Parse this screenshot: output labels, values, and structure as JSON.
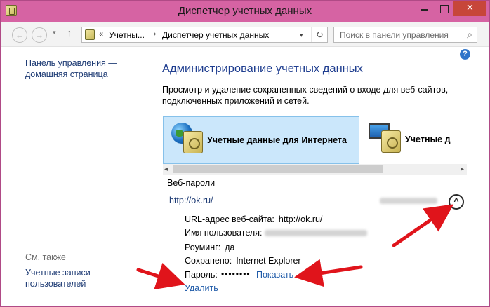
{
  "window": {
    "title": "Диспетчер учетных данных",
    "close_glyph": "✕"
  },
  "nav": {
    "back_glyph": "←",
    "forward_glyph": "→",
    "up_glyph": "↑",
    "dropdown_glyph": "▾",
    "address_chevron": "«",
    "address_segments": [
      "Учетны...",
      "Диспетчер учетных данных"
    ],
    "address_sep": "›",
    "refresh_glyph": "↻",
    "search_placeholder": "Поиск в панели управления",
    "search_glyph": "⌕"
  },
  "help_glyph": "?",
  "left_pane": {
    "home_link": "Панель управления — домашняя страница",
    "see_also": "См. также",
    "user_accounts_link": "Учетные записи пользователей"
  },
  "main": {
    "heading": "Администрирование учетных данных",
    "description": "Просмотр и удаление сохраненных сведений о входе для веб-сайтов, подключенных приложений и сетей.",
    "tiles": [
      {
        "label": "Учетные данные для Интернета",
        "icon": "globe-icon",
        "selected": true
      },
      {
        "label": "Учетные д",
        "icon": "monitor-icon",
        "selected": false
      }
    ],
    "scroll_left_glyph": "◂",
    "scroll_right_glyph": "▸",
    "section_title": "Веб-пароли",
    "entry": {
      "url": "http://ok.ru/",
      "collapse_glyph": "^",
      "details": [
        {
          "label": "URL-адрес веб-сайта:",
          "value": "http://ok.ru/"
        },
        {
          "label": "Имя пользователя:",
          "value": ""
        },
        {
          "label": "Роуминг:",
          "value": "да"
        },
        {
          "label": "Сохранено:",
          "value": "Internet Explorer"
        },
        {
          "label": "Пароль:",
          "value": ""
        }
      ],
      "password_mask": "••••••••",
      "show_link": "Показать",
      "delete_link": "Удалить"
    }
  },
  "colors": {
    "titlebar": "#d663a3",
    "close_button": "#c7463a",
    "heading": "#1e3d8f",
    "link": "#1e5aa8",
    "selected_tile": "#cbe7fb",
    "annotation_arrow": "#e0141b"
  }
}
